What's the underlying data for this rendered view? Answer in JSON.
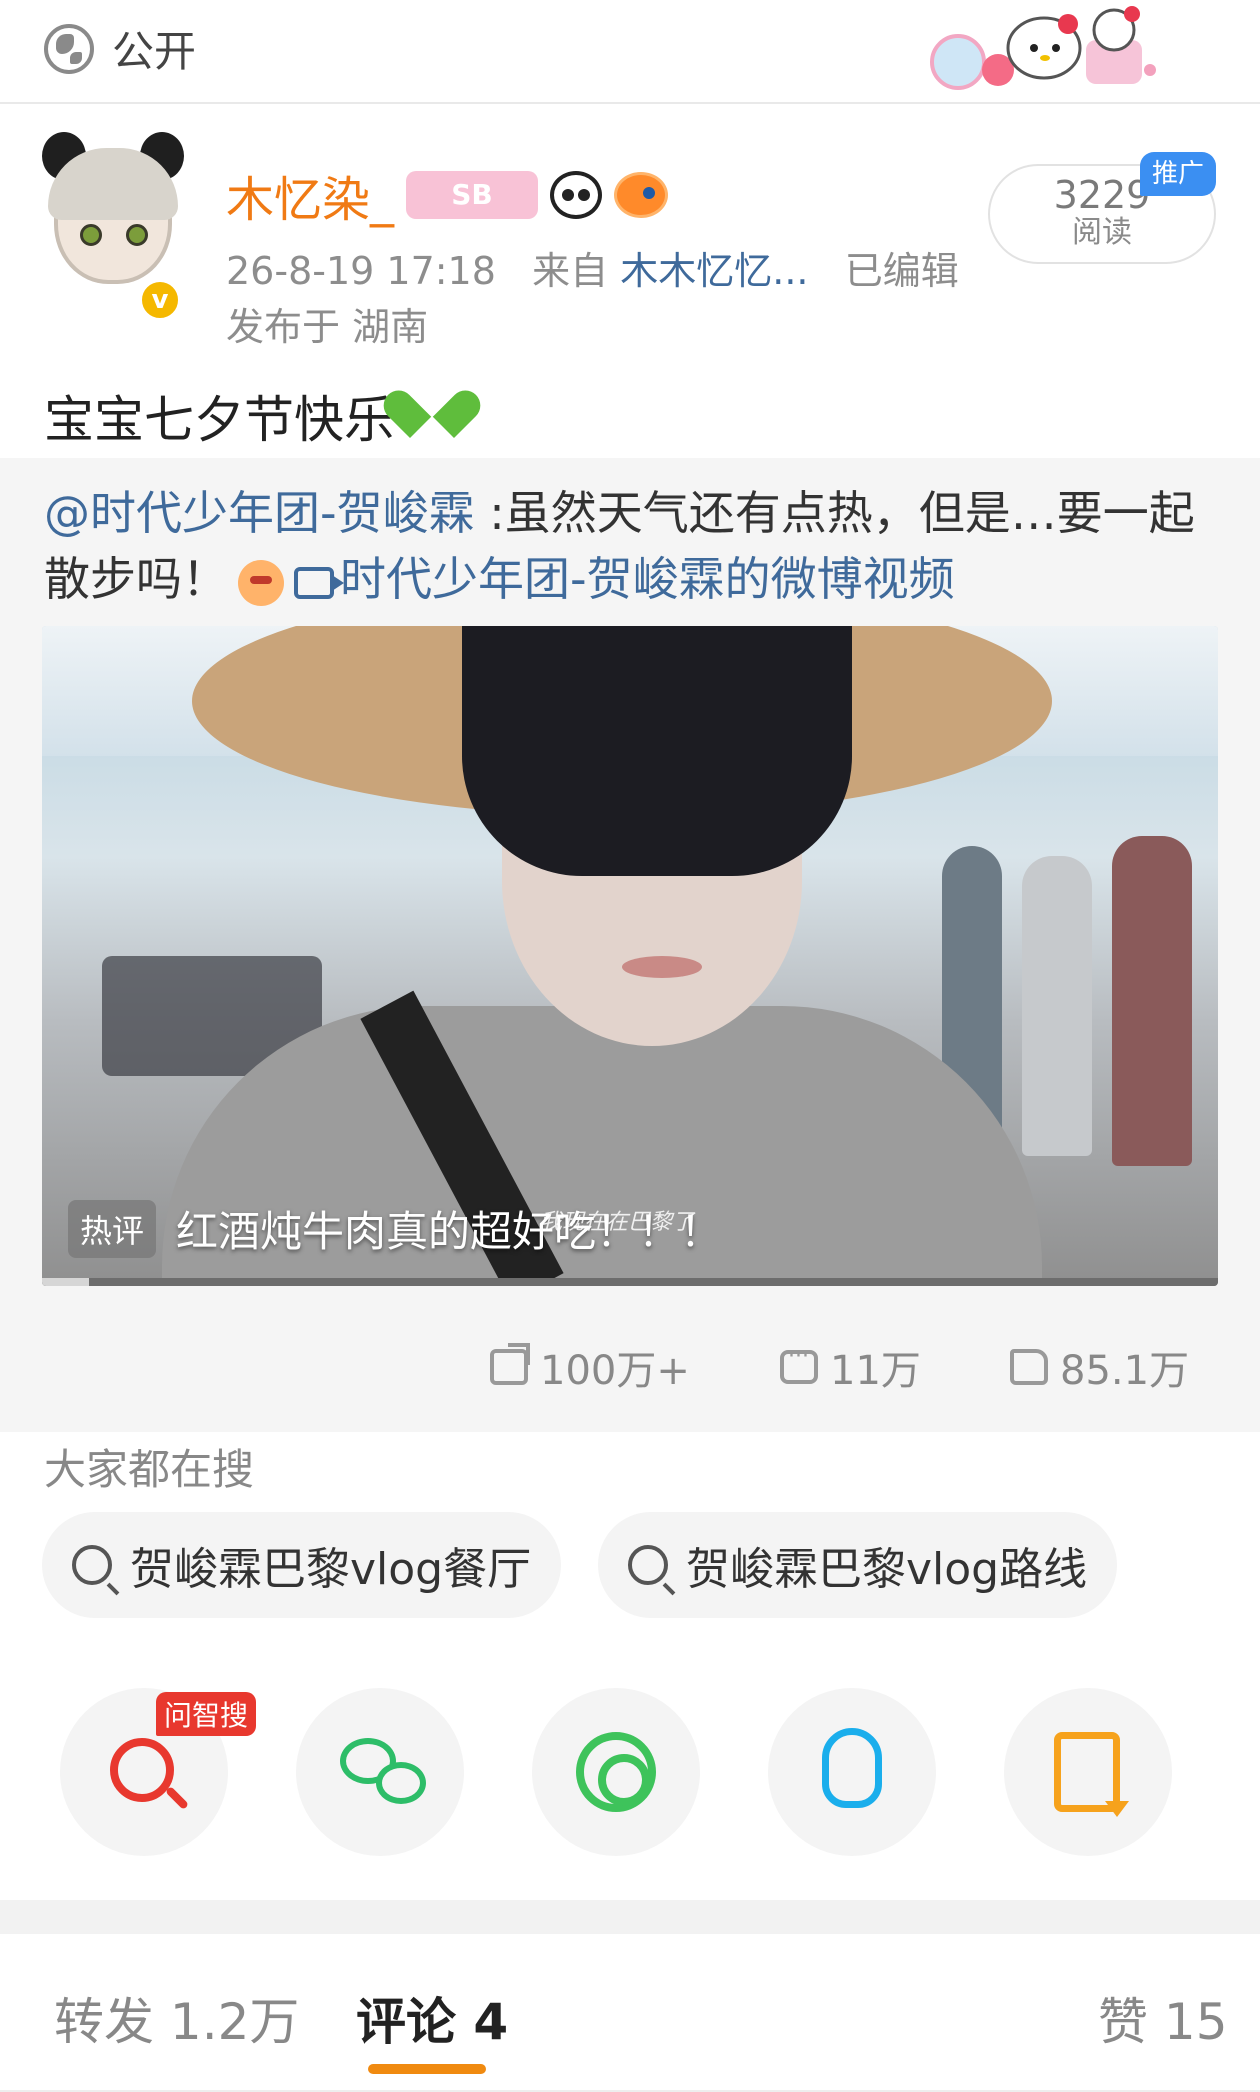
{
  "topbar": {
    "visibility_label": "公开"
  },
  "author": {
    "username": "木忆染_",
    "badge_text": "SB",
    "time": "26-8-19 17:18",
    "source_prefix": "来自",
    "source": "木木忆忆...",
    "edited": "已编辑",
    "location": "发布于 湖南",
    "verified_mark": "v"
  },
  "reads": {
    "count": "3229",
    "label": "阅读",
    "promo": "推广"
  },
  "post": {
    "text": "宝宝七夕节快乐"
  },
  "repost": {
    "mention": "@时代少年团-贺峻霖",
    "text": " :虽然天气还有点热，但是…要一起散步吗！",
    "video_link": "时代少年团-贺峻霖的微博视频",
    "video": {
      "hot_tag": "热评",
      "hot_comment": "红酒炖牛肉真的超好吃！！！",
      "subtitle": "我现在在巴黎了",
      "progress": 0.04
    },
    "stats": {
      "reposts": "100万+",
      "comments": "11万",
      "likes": "85.1万"
    }
  },
  "hot_search": {
    "title": "大家都在搜",
    "items": [
      "贺峻霖巴黎vlog餐厅",
      "贺峻霖巴黎vlog路线"
    ]
  },
  "share": {
    "ai_tag": "问智搜",
    "icons": [
      "ai-search-icon",
      "wechat-icon",
      "moments-icon",
      "qq-icon",
      "save-image-icon"
    ]
  },
  "tabs": {
    "repost": "转发 1.2万",
    "comment": "评论 4",
    "like": "赞 15"
  },
  "colors": {
    "accent_orange": "#f08a10",
    "username": "#f07a14",
    "link": "#3f6a9b",
    "promo_blue": "#3b8ff2"
  }
}
